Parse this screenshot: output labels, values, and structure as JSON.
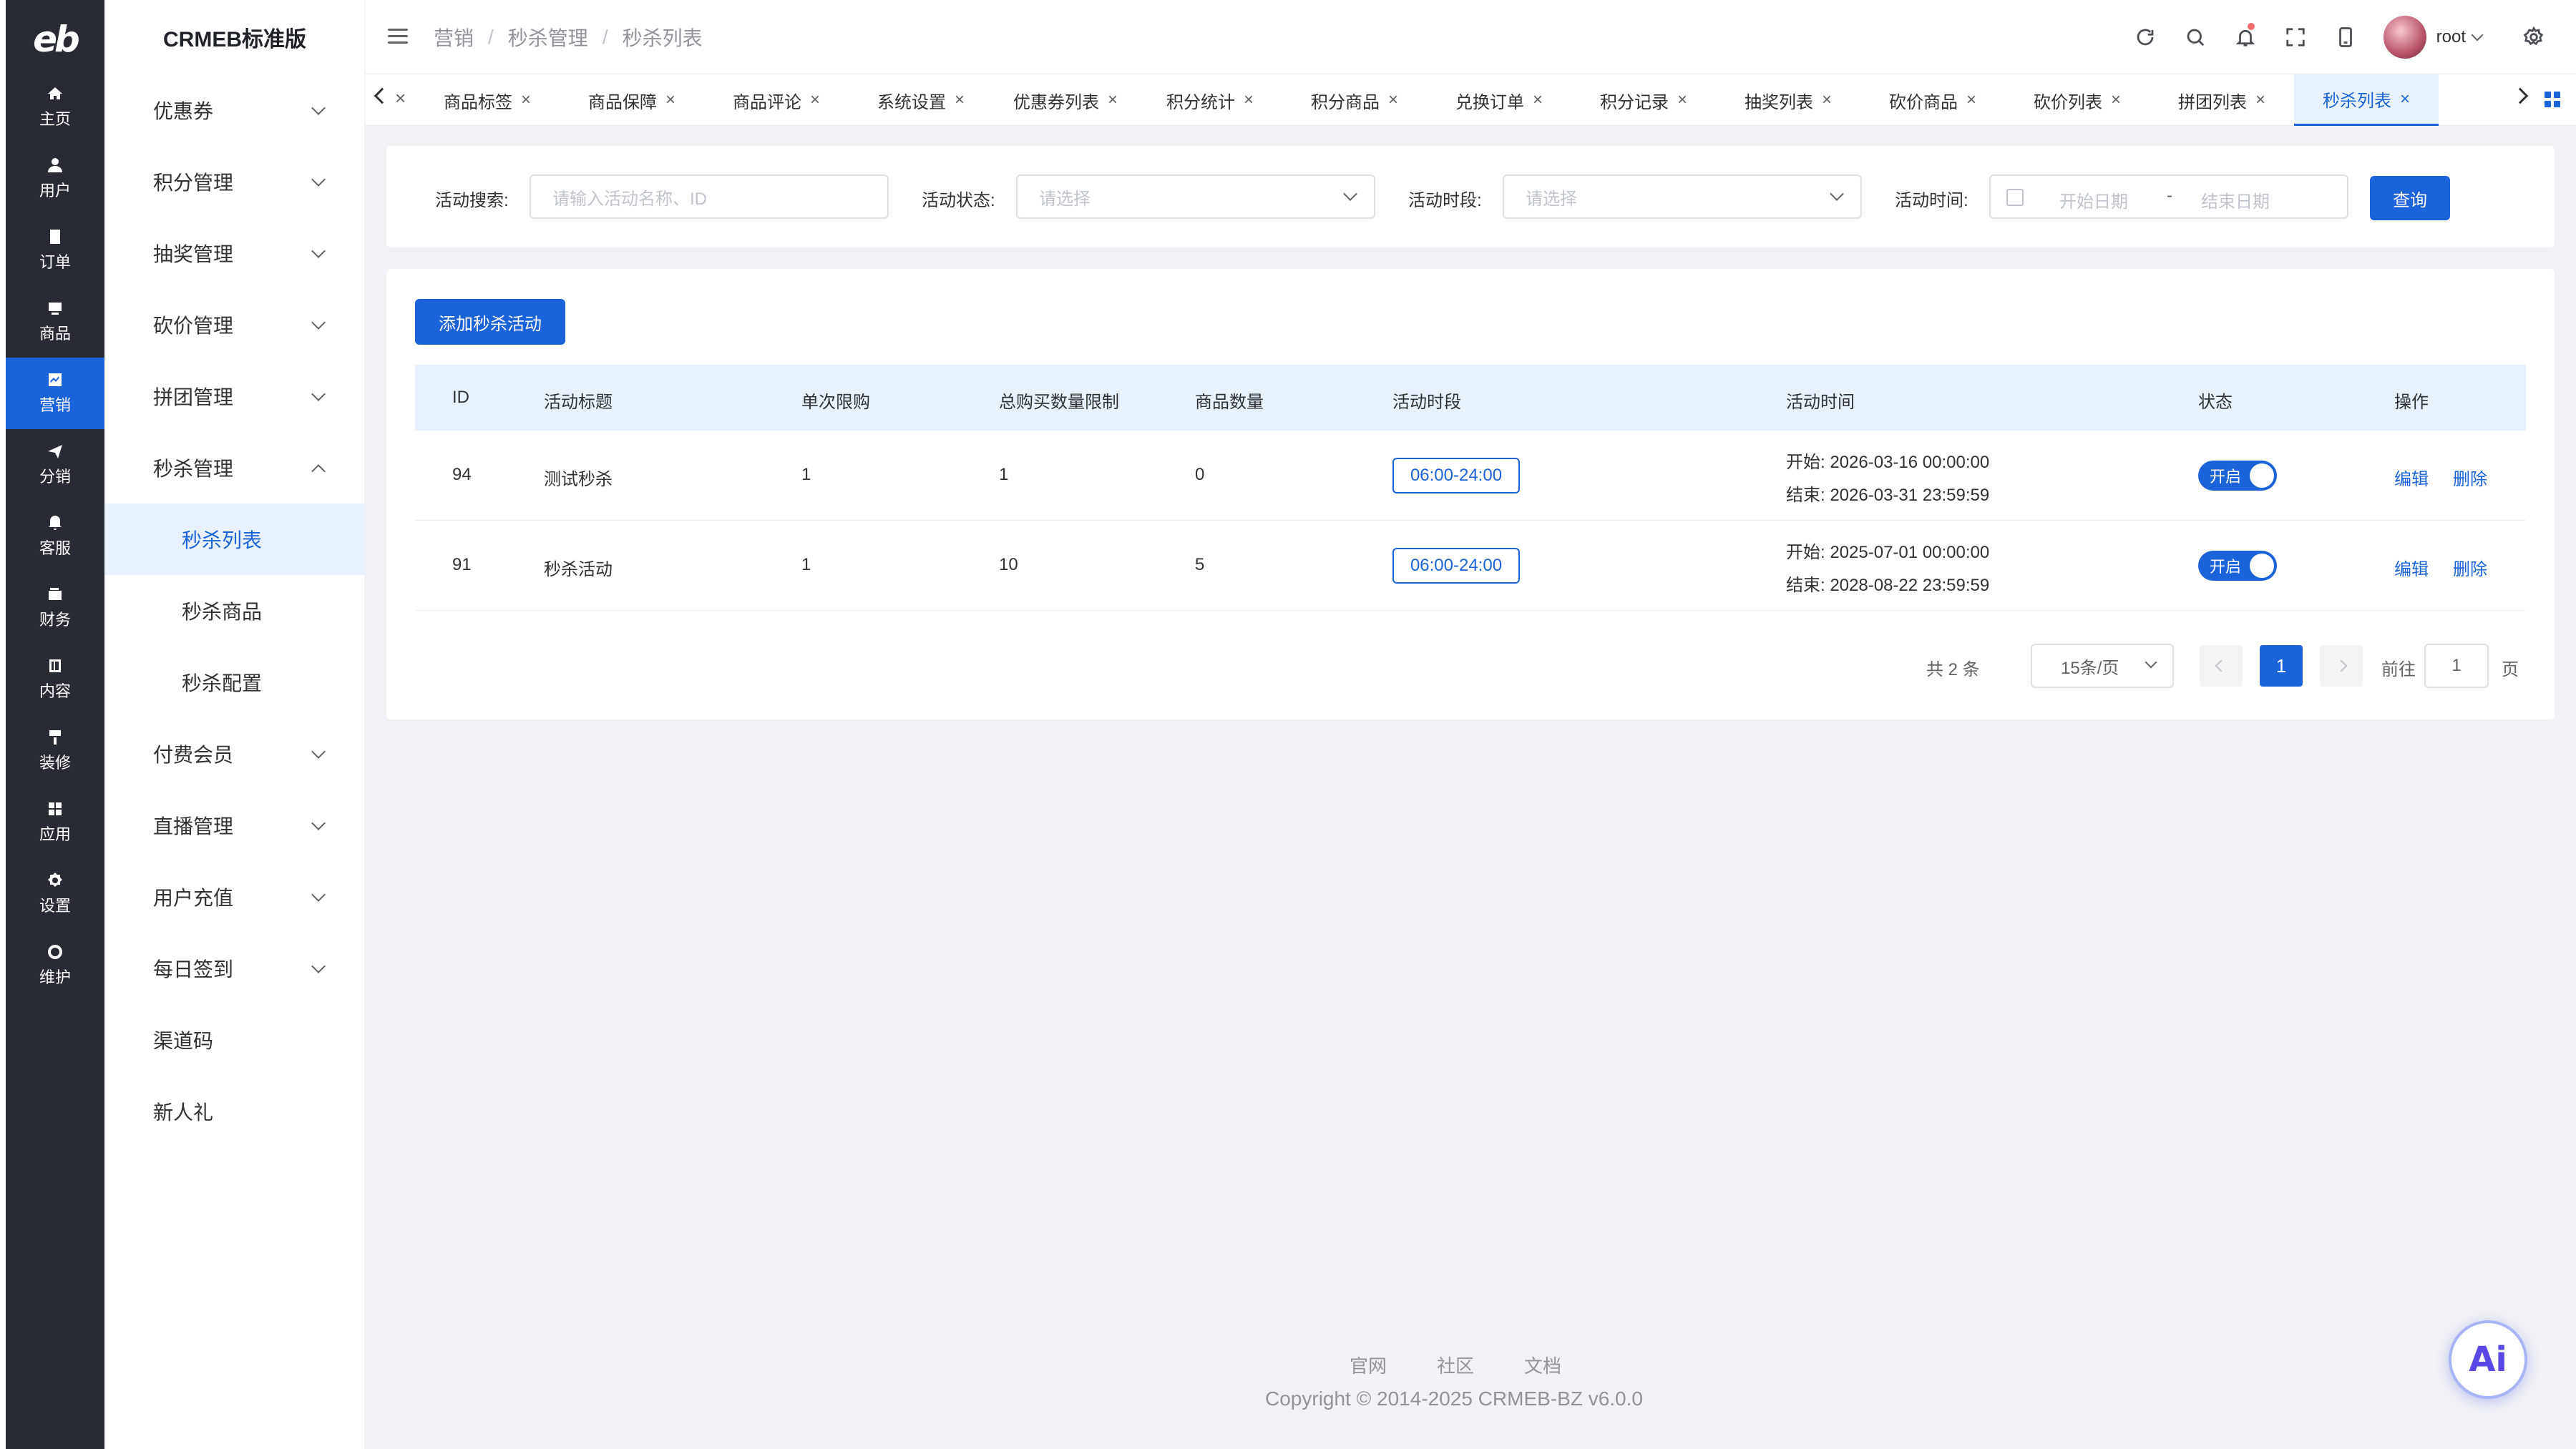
{
  "rail": {
    "logo": "eb",
    "items": [
      {
        "label": "主页",
        "icon": "home-icon"
      },
      {
        "label": "用户",
        "icon": "user-icon"
      },
      {
        "label": "订单",
        "icon": "order-icon"
      },
      {
        "label": "商品",
        "icon": "product-icon"
      },
      {
        "label": "营销",
        "icon": "marketing-icon"
      },
      {
        "label": "分销",
        "icon": "distribution-icon"
      },
      {
        "label": "客服",
        "icon": "service-icon"
      },
      {
        "label": "财务",
        "icon": "finance-icon"
      },
      {
        "label": "内容",
        "icon": "content-icon"
      },
      {
        "label": "装修",
        "icon": "decoration-icon"
      },
      {
        "label": "应用",
        "icon": "apps-icon"
      },
      {
        "label": "设置",
        "icon": "settings-icon"
      },
      {
        "label": "维护",
        "icon": "maintenance-icon"
      }
    ],
    "active": "营销"
  },
  "submenu": {
    "brand": "CRMEB标准版",
    "items": [
      {
        "label": "优惠券"
      },
      {
        "label": "积分管理"
      },
      {
        "label": "抽奖管理"
      },
      {
        "label": "砍价管理"
      },
      {
        "label": "拼团管理"
      },
      {
        "label": "秒杀管理"
      },
      {
        "label": "秒杀列表"
      },
      {
        "label": "秒杀商品"
      },
      {
        "label": "秒杀配置"
      },
      {
        "label": "付费会员"
      },
      {
        "label": "直播管理"
      },
      {
        "label": "用户充值"
      },
      {
        "label": "每日签到"
      },
      {
        "label": "渠道码"
      },
      {
        "label": "新人礼"
      }
    ]
  },
  "header": {
    "breadcrumbs": [
      "营销",
      "/",
      "秒杀管理",
      "/",
      "秒杀列表"
    ],
    "user_name": "root"
  },
  "tabs": [
    "商品标签",
    "商品保障",
    "商品评论",
    "系统设置",
    "优惠券列表",
    "积分统计",
    "积分商品",
    "兑换订单",
    "积分记录",
    "抽奖列表",
    "砍价商品",
    "砍价列表",
    "拼团列表",
    "秒杀列表"
  ],
  "filter": {
    "search_label": "活动搜索:",
    "search_placeholder": "请输入活动名称、ID",
    "status_label": "活动状态:",
    "status_placeholder": "请选择",
    "period_label": "活动时段:",
    "period_placeholder": "请选择",
    "time_label": "活动时间:",
    "start_placeholder": "开始日期",
    "range_sep": "-",
    "end_placeholder": "结束日期",
    "query_button": "查询"
  },
  "table": {
    "add_button": "添加秒杀活动",
    "columns": [
      "ID",
      "活动标题",
      "单次限购",
      "总购买数量限制",
      "商品数量",
      "活动时段",
      "活动时间",
      "状态",
      "操作"
    ],
    "rows": [
      {
        "id": "94",
        "title": "测试秒杀",
        "single_limit": "1",
        "total_limit": "1",
        "product_count": "0",
        "period": "06:00-24:00",
        "start": "开始: 2026-03-16 00:00:00",
        "end": "结束: 2026-03-31 23:59:59",
        "status": "开启",
        "edit": "编辑",
        "delete": "删除"
      },
      {
        "id": "91",
        "title": "秒杀活动",
        "single_limit": "1",
        "total_limit": "10",
        "product_count": "5",
        "period": "06:00-24:00",
        "start": "开始: 2025-07-01 00:00:00",
        "end": "结束: 2028-08-22 23:59:59",
        "status": "开启",
        "edit": "编辑",
        "delete": "删除"
      }
    ]
  },
  "pagination": {
    "total": "共 2 条",
    "page_size": "15条/页",
    "current_page": "1",
    "goto_label": "前往",
    "goto_value": "1",
    "page_suffix": "页"
  },
  "footer": {
    "links": [
      "官网",
      "社区",
      "文档"
    ],
    "copyright": "Copyright © 2014-2025 CRMEB-BZ v6.0.0"
  },
  "ai_button": "Ai",
  "colors": {
    "primary": "#1a63d8",
    "rail_bg": "#282b33",
    "page_bg": "#f0f2f5"
  }
}
